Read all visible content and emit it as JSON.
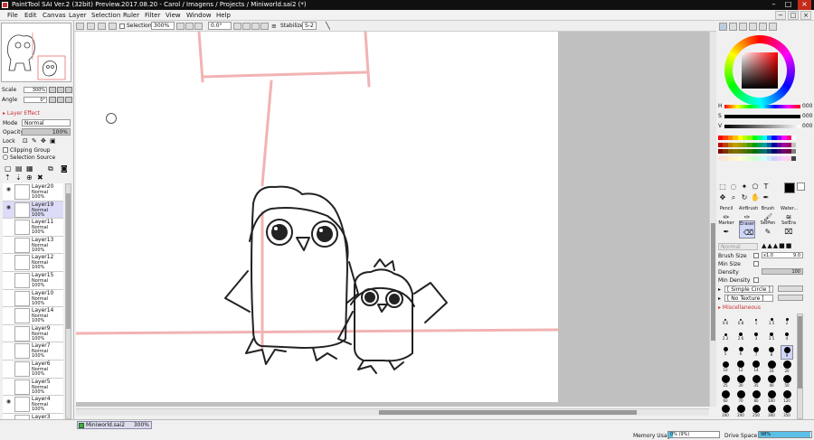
{
  "window": {
    "title": "PaintTool SAI Ver.2 (32bit) Preview.2017.08.20 - Carol / Imagens / Projects / Miniworld.sai2 (*)",
    "controls": [
      "–",
      "□",
      "×"
    ]
  },
  "menu": {
    "items": [
      "File",
      "Edit",
      "Canvas",
      "Layer",
      "Selection",
      "Ruler",
      "Filter",
      "View",
      "Window",
      "Help"
    ],
    "right_buttons": [
      "−",
      "□",
      "×"
    ]
  },
  "toolbar": {
    "selection_label": "Selection",
    "zoom": "300%",
    "rotation": "0.0°",
    "stabilizer_label": "Stabilizer",
    "stabilizer_value": "S-2"
  },
  "navigator": {
    "scale_label": "Scale",
    "scale_value": "300%",
    "angle_label": "Angle",
    "angle_value": "0°"
  },
  "layer_effect": {
    "header": "Layer Effect",
    "mode_label": "Mode",
    "mode_value": "Normal",
    "opacity_label": "Opacity",
    "opacity_value": "100%",
    "opacity_level": 1.0,
    "lock_label": "Lock",
    "clipping_label": "Clipping Group",
    "selection_source_label": "Selection Source"
  },
  "layers": [
    {
      "name": "Layer20",
      "mode": "Normal",
      "opacity": "100%",
      "visible": true,
      "selected": false
    },
    {
      "name": "Layer19",
      "mode": "Normal",
      "opacity": "100%",
      "visible": true,
      "selected": true
    },
    {
      "name": "Layer11",
      "mode": "Normal",
      "opacity": "100%",
      "visible": false,
      "selected": false
    },
    {
      "name": "Layer13",
      "mode": "Normal",
      "opacity": "100%",
      "visible": false,
      "selected": false
    },
    {
      "name": "Layer12",
      "mode": "Normal",
      "opacity": "100%",
      "visible": false,
      "selected": false
    },
    {
      "name": "Layer15",
      "mode": "Normal",
      "opacity": "100%",
      "visible": false,
      "selected": false
    },
    {
      "name": "Layer10",
      "mode": "Normal",
      "opacity": "100%",
      "visible": false,
      "selected": false
    },
    {
      "name": "Layer14",
      "mode": "Normal",
      "opacity": "100%",
      "visible": false,
      "selected": false
    },
    {
      "name": "Layer9",
      "mode": "Normal",
      "opacity": "100%",
      "visible": false,
      "selected": false
    },
    {
      "name": "Layer7",
      "mode": "Normal",
      "opacity": "100%",
      "visible": false,
      "selected": false
    },
    {
      "name": "Layer6",
      "mode": "Normal",
      "opacity": "100%",
      "visible": false,
      "selected": false
    },
    {
      "name": "Layer5",
      "mode": "Normal",
      "opacity": "100%",
      "visible": false,
      "selected": false
    },
    {
      "name": "Layer4",
      "mode": "Normal",
      "opacity": "100%",
      "visible": true,
      "selected": false
    },
    {
      "name": "Layer3",
      "mode": "Normal",
      "opacity": "100%",
      "visible": false,
      "selected": false
    }
  ],
  "status": {
    "file_tab": "Miniworld.sai2",
    "file_zoom": "300%",
    "memory_label": "Memory Usage",
    "memory_value": "0% (9%)",
    "memory_level": 0.09,
    "drive_label": "Drive Space",
    "drive_value": "98%",
    "drive_level": 0.98
  },
  "color": {
    "current": "#000000",
    "h_label": "H",
    "h_value": "000",
    "s_label": "S",
    "s_value": "000",
    "v_label": "V",
    "v_value": "000"
  },
  "tools": {
    "brushes": [
      {
        "name": "Pencil",
        "selected": false
      },
      {
        "name": "AirBrush",
        "selected": false
      },
      {
        "name": "Brush",
        "selected": false
      },
      {
        "name": "Water...",
        "selected": false
      },
      {
        "name": "Marker",
        "selected": false
      },
      {
        "name": "Eraser",
        "selected": true
      },
      {
        "name": "SelPen",
        "selected": false
      },
      {
        "name": "SelEra",
        "selected": false
      }
    ],
    "blend_mode": "Normal",
    "brush_size_label": "Brush Size",
    "brush_size_mult": "x1.0",
    "brush_size_value": "9.0",
    "min_size_label": "Min Size",
    "density_label": "Density",
    "density_value": "100",
    "min_density_label": "Min Density",
    "shape_value": "[ Simple Circle ]",
    "texture_value": "[ No Texture ]",
    "misc_label": "Miscellaneous",
    "sizes": [
      "0.6",
      "0.8",
      "1",
      "1.5",
      "2",
      "2.3",
      "2.6",
      "3",
      "3.5",
      "4",
      "5",
      "6",
      "7",
      "8",
      "9",
      "10",
      "12",
      "14",
      "16",
      "20",
      "25",
      "30",
      "35",
      "40",
      "50",
      "60",
      "70",
      "80",
      "100",
      "120",
      "160",
      "200",
      "250",
      "300",
      "350"
    ],
    "selected_size": "9"
  }
}
